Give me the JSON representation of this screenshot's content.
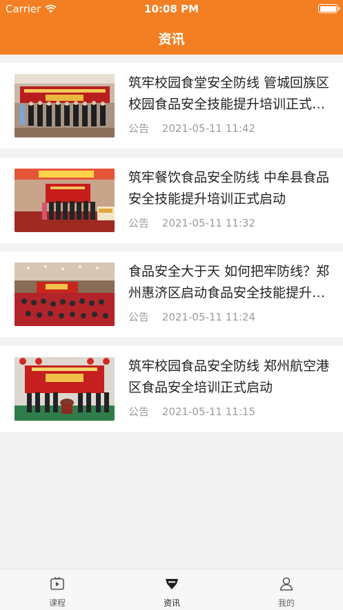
{
  "status_bar": {
    "carrier": "Carrier",
    "time": "10:08 PM"
  },
  "header": {
    "title": "资讯"
  },
  "articles": [
    {
      "title": "筑牢校园食堂安全防线 管城回族区校园食品安全技能提升培训正式启动",
      "category": "公告",
      "date": "2021-05-11 11:42",
      "thumb_icon": "banquet-hall-photo"
    },
    {
      "title": "筑牢餐饮食品安全防线 中牟县食品安全技能提升培训正式启动",
      "category": "公告",
      "date": "2021-05-11 11:32",
      "thumb_icon": "stage-group-photo"
    },
    {
      "title": "食品安全大于天 如何把牢防线？郑州惠济区启动食品安全技能提升培训",
      "category": "公告",
      "date": "2021-05-11 11:24",
      "thumb_icon": "auditorium-photo"
    },
    {
      "title": "筑牢校园食品安全防线 郑州航空港区食品安全培训正式启动",
      "category": "公告",
      "date": "2021-05-11 11:15",
      "thumb_icon": "launch-ceremony-photo"
    }
  ],
  "tabbar": {
    "items": [
      {
        "label": "课程",
        "icon": "play-video-icon"
      },
      {
        "label": "资讯",
        "icon": "news-icon"
      },
      {
        "label": "我的",
        "icon": "profile-icon"
      }
    ],
    "active": 1
  },
  "colors": {
    "accent": "#f37f22",
    "background": "#f2f2f2",
    "text": "#222222",
    "meta": "#9a9a9a"
  }
}
